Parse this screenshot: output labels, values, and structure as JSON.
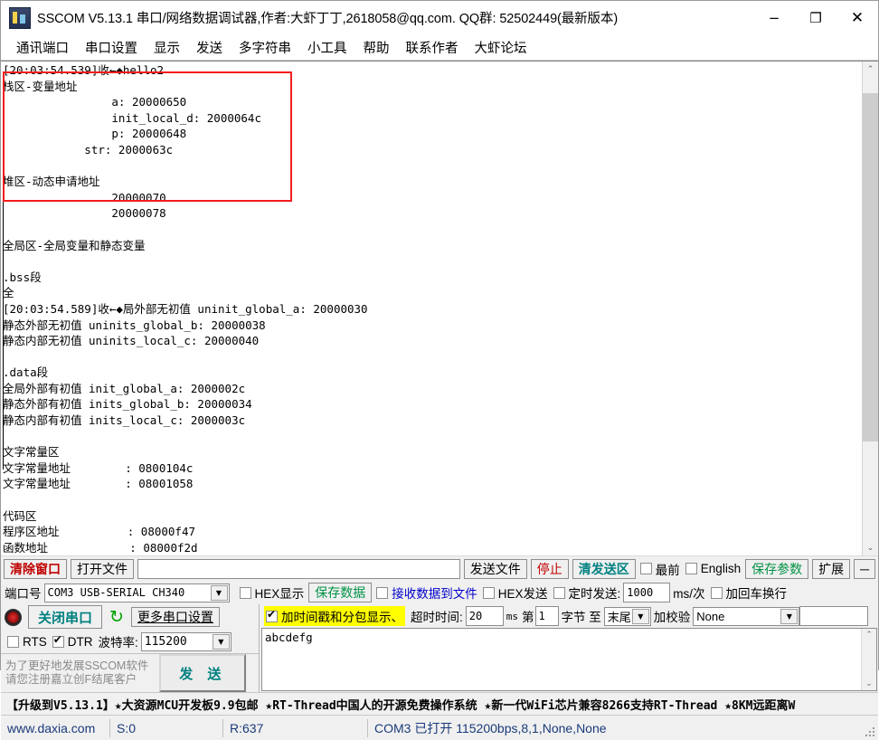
{
  "window": {
    "title": "SSCOM V5.13.1 串口/网络数据调试器,作者:大虾丁丁,2618058@qq.com. QQ群: 52502449(最新版本)",
    "icon": "sscom-app-icon",
    "minimize": "−",
    "maximize": "❐",
    "close": "✕"
  },
  "menu": {
    "items": [
      {
        "label": "通讯端口"
      },
      {
        "label": "串口设置"
      },
      {
        "label": "显示"
      },
      {
        "label": "发送"
      },
      {
        "label": "多字符串"
      },
      {
        "label": "小工具"
      },
      {
        "label": "帮助"
      },
      {
        "label": "联系作者"
      },
      {
        "label": "大虾论坛"
      }
    ]
  },
  "terminal": {
    "lines": [
      "[20:03:54.539]收←◆hello2",
      "栈区-变量地址",
      "                a: 20000650",
      "                init_local_d: 2000064c",
      "                p: 20000648",
      "            str: 2000063c",
      "",
      "堆区-动态申请地址",
      "                20000070",
      "                20000078",
      "",
      "全局区-全局变量和静态变量",
      "",
      ".bss段",
      "全",
      "[20:03:54.589]收←◆局外部无初值 uninit_global_a: 20000030",
      "静态外部无初值 uninits_global_b: 20000038",
      "静态内部无初值 uninits_local_c: 20000040",
      "",
      ".data段",
      "全局外部有初值 init_global_a: 2000002c",
      "静态外部有初值 inits_global_b: 20000034",
      "静态内部有初值 inits_local_c: 2000003c",
      "",
      "文字常量区",
      "文字常量地址        : 0800104c",
      "文字常量地址        : 08001058",
      "",
      "代码区",
      "程序区地址          : 08000f47",
      "函数地址            : 08000f2d"
    ],
    "highlight_box_color": "#f21d1d",
    "scrollbar": {
      "up": "⌃",
      "down": "⌄"
    }
  },
  "toolbar_row1": {
    "clear_window": "清除窗口",
    "open_file": "打开文件",
    "file_path": "",
    "file_path_placeholder": "",
    "send_file": "发送文件",
    "stop": "停止",
    "clear_send": "清发送区",
    "topmost": "最前",
    "english": "English",
    "save_params": "保存参数",
    "extend": "扩展",
    "collapse": "─"
  },
  "toolbar_row2": {
    "port_label": "端口号",
    "port_value": "COM3 USB-SERIAL CH340",
    "hex_display": "HEX显示",
    "save_data": "保存数据",
    "recv_to_file": "接收数据到文件",
    "hex_send": "HEX发送",
    "timed_send": "定时发送:",
    "timed_value": "1000",
    "timed_unit": "ms/次",
    "add_crlf": "加回车换行"
  },
  "port_panel": {
    "close_port": "关闭串口",
    "refresh_icon": "↻",
    "more_settings": "更多串口设置",
    "rts": "RTS",
    "dtr": "DTR",
    "baud_label": "波特率:",
    "baud_value": "115200"
  },
  "promo": {
    "line1": "为了更好地发展SSCOM软件",
    "line2": "请您注册嘉立创F结尾客户",
    "send_button": "发 送"
  },
  "send_options": {
    "timestamp_packet": "加时间戳和分包显示、",
    "timeout_label": "超时时间:",
    "timeout_value": "20",
    "timeout_unit": "ms",
    "byte_prefix": "第",
    "byte_value": "1",
    "byte_suffix": "字节 至",
    "byte_end": "末尾",
    "checksum_label": "加校验",
    "checksum_value": "None",
    "checksum_extra": ""
  },
  "send_area": {
    "text": "abcdefg"
  },
  "adbar": {
    "text": "【升级到V5.13.1】★大资源MCU开发板9.9包邮 ★RT-Thread中国人的开源免费操作系统 ★新一代WiFi芯片兼容8266支持RT-Thread ★8KM远距离W"
  },
  "statusbar": {
    "site": "www.daxia.com",
    "sent": "S:0",
    "received": "R:637",
    "port_status": "COM3 已打开  115200bps,8,1,None,None"
  },
  "colors": {
    "accent_green": "#009245",
    "accent_red": "#c00000",
    "accent_teal": "#008080",
    "highlight_yellow": "#ffff00",
    "status_blue": "#1a3a7a"
  }
}
